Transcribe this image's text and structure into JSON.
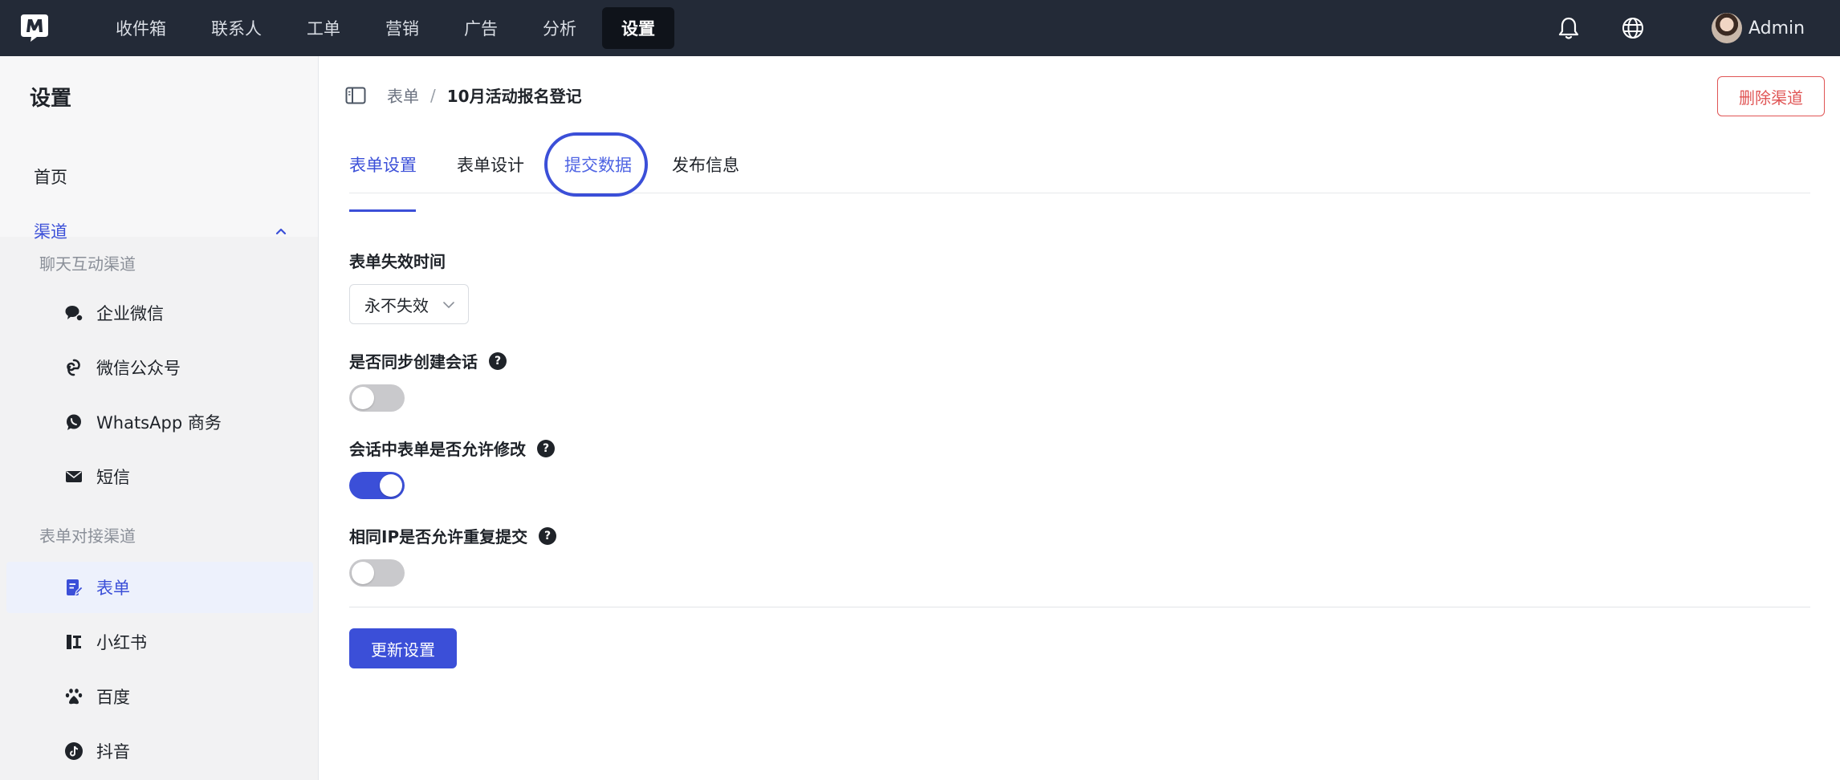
{
  "topbar": {
    "nav": [
      {
        "label": "收件箱"
      },
      {
        "label": "联系人"
      },
      {
        "label": "工单"
      },
      {
        "label": "营销"
      },
      {
        "label": "广告"
      },
      {
        "label": "分析"
      },
      {
        "label": "设置",
        "active": true
      }
    ],
    "user_name": "Admin",
    "icons": [
      "logo-icon",
      "bell-icon",
      "globe-icon"
    ]
  },
  "sidebar": {
    "title": "设置",
    "home": "首页",
    "channel": "渠道",
    "group_chat": "聊天互动渠道",
    "chat_items": [
      {
        "label": "企业微信",
        "icon": "wecom-icon"
      },
      {
        "label": "微信公众号",
        "icon": "wechat-official-icon"
      },
      {
        "label": "WhatsApp 商务",
        "icon": "whatsapp-icon"
      },
      {
        "label": "短信",
        "icon": "mail-icon"
      }
    ],
    "group_form": "表单对接渠道",
    "form_items": [
      {
        "label": "表单",
        "icon": "form-icon",
        "selected": true
      },
      {
        "label": "小红书",
        "icon": "xiaohongshu-icon"
      },
      {
        "label": "百度",
        "icon": "baidu-icon"
      },
      {
        "label": "抖音",
        "icon": "douyin-icon"
      }
    ],
    "accent_color": "#3b4fd8"
  },
  "breadcrumb": {
    "parent": "表单",
    "separator": "/",
    "current": "10月活动报名登记"
  },
  "actions": {
    "delete": "删除渠道",
    "update": "更新设置"
  },
  "tabs": [
    {
      "label": "表单设置",
      "active": true
    },
    {
      "label": "表单设计"
    },
    {
      "label": "提交数据",
      "highlighted": true
    },
    {
      "label": "发布信息"
    }
  ],
  "form": {
    "expire_label": "表单失效时间",
    "expire_value": "永不失效",
    "sync_label": "是否同步创建会话",
    "sync_on": false,
    "edit_label": "会话中表单是否允许修改",
    "edit_on": true,
    "ip_label": "相同IP是否允许重复提交",
    "ip_on": false,
    "help_glyph": "?"
  }
}
